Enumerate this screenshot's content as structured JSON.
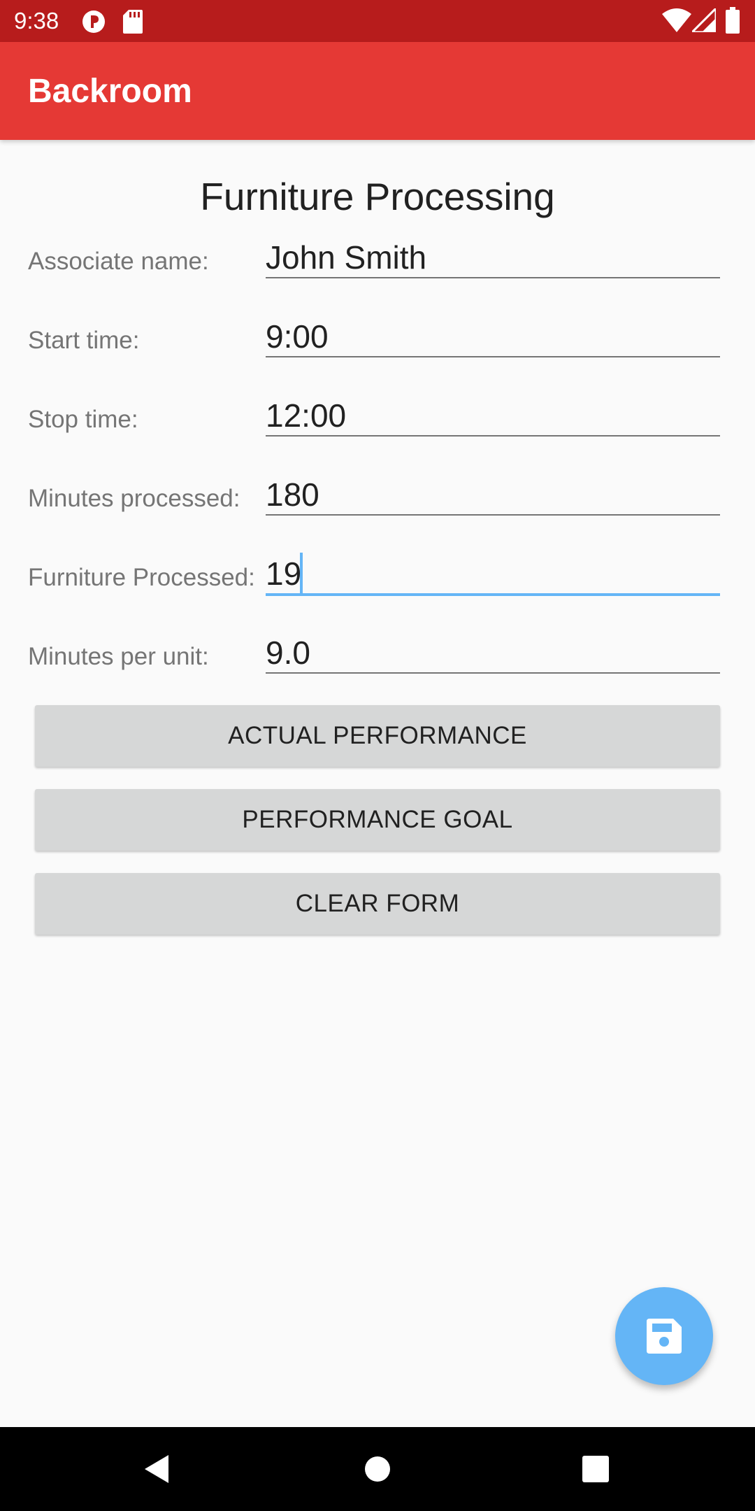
{
  "status_bar": {
    "time": "9:38",
    "icons": [
      "app-notification-icon",
      "sd-card-icon",
      "wifi-icon",
      "cellular-signal-icon",
      "battery-icon"
    ]
  },
  "app_bar": {
    "title": "Backroom"
  },
  "form": {
    "title": "Furniture Processing",
    "fields": [
      {
        "label": "Associate name:",
        "value": "John Smith"
      },
      {
        "label": "Start time:",
        "value": "9:00"
      },
      {
        "label": "Stop time:",
        "value": "12:00"
      },
      {
        "label": "Minutes processed:",
        "value": "180"
      },
      {
        "label": "Furniture Processed:",
        "value": "19"
      },
      {
        "label": "Minutes per unit:",
        "value": "9.0"
      }
    ]
  },
  "buttons": {
    "actual_performance": "ACTUAL PERFORMANCE",
    "performance_goal": "PERFORMANCE GOAL",
    "clear_form": "CLEAR FORM"
  },
  "fab": {
    "icon": "save-icon"
  },
  "colors": {
    "status_bar": "#b71c1c",
    "app_bar": "#e53935",
    "accent": "#64b5f6",
    "button_bg": "#d6d7d7"
  }
}
